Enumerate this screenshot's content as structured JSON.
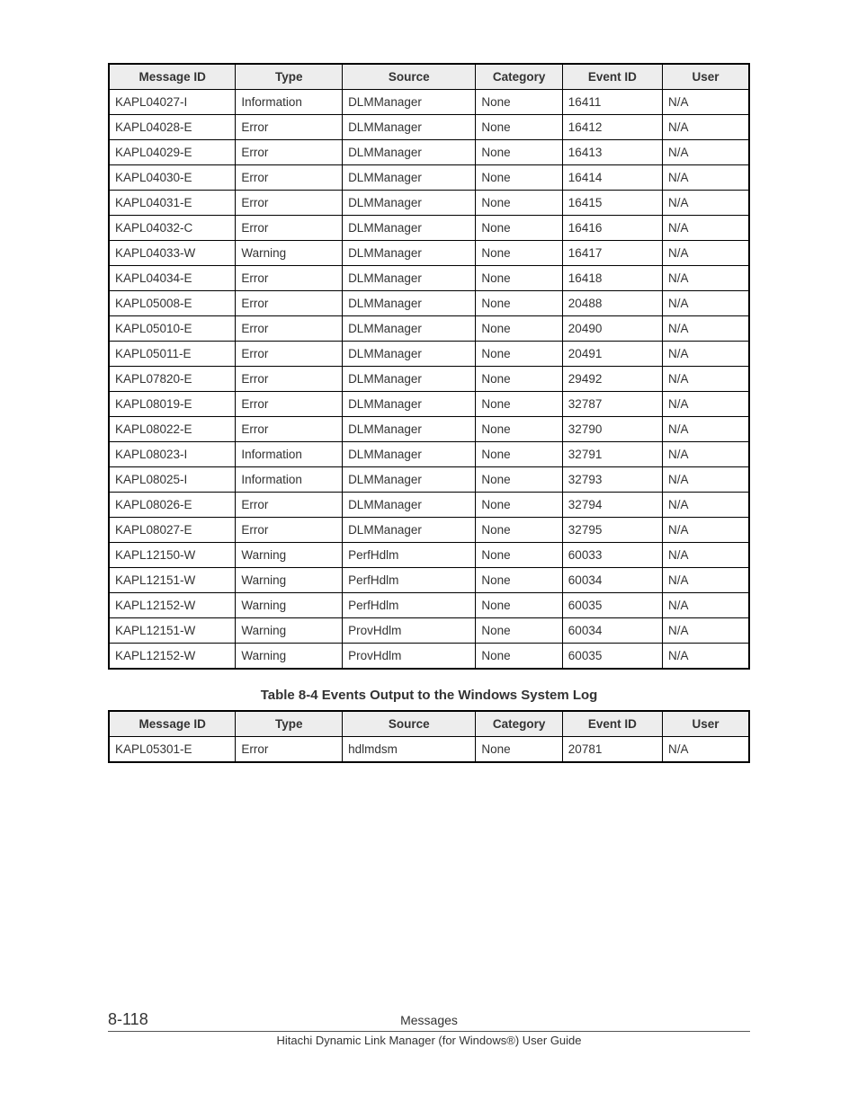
{
  "table1": {
    "headers": [
      "Message ID",
      "Type",
      "Source",
      "Category",
      "Event ID",
      "User"
    ],
    "rows": [
      [
        "KAPL04027-I",
        "Information",
        "DLMManager",
        "None",
        "16411",
        "N/A"
      ],
      [
        "KAPL04028-E",
        "Error",
        "DLMManager",
        "None",
        "16412",
        "N/A"
      ],
      [
        "KAPL04029-E",
        "Error",
        "DLMManager",
        "None",
        "16413",
        "N/A"
      ],
      [
        "KAPL04030-E",
        "Error",
        "DLMManager",
        "None",
        "16414",
        "N/A"
      ],
      [
        "KAPL04031-E",
        "Error",
        "DLMManager",
        "None",
        "16415",
        "N/A"
      ],
      [
        "KAPL04032-C",
        "Error",
        "DLMManager",
        "None",
        "16416",
        "N/A"
      ],
      [
        "KAPL04033-W",
        "Warning",
        "DLMManager",
        "None",
        "16417",
        "N/A"
      ],
      [
        "KAPL04034-E",
        "Error",
        "DLMManager",
        "None",
        "16418",
        "N/A"
      ],
      [
        "KAPL05008-E",
        "Error",
        "DLMManager",
        "None",
        "20488",
        "N/A"
      ],
      [
        "KAPL05010-E",
        "Error",
        "DLMManager",
        "None",
        "20490",
        "N/A"
      ],
      [
        "KAPL05011-E",
        "Error",
        "DLMManager",
        "None",
        "20491",
        "N/A"
      ],
      [
        "KAPL07820-E",
        "Error",
        "DLMManager",
        "None",
        "29492",
        "N/A"
      ],
      [
        "KAPL08019-E",
        "Error",
        "DLMManager",
        "None",
        "32787",
        "N/A"
      ],
      [
        "KAPL08022-E",
        "Error",
        "DLMManager",
        "None",
        "32790",
        "N/A"
      ],
      [
        "KAPL08023-I",
        "Information",
        "DLMManager",
        "None",
        "32791",
        "N/A"
      ],
      [
        "KAPL08025-I",
        "Information",
        "DLMManager",
        "None",
        "32793",
        "N/A"
      ],
      [
        "KAPL08026-E",
        "Error",
        "DLMManager",
        "None",
        "32794",
        "N/A"
      ],
      [
        "KAPL08027-E",
        "Error",
        "DLMManager",
        "None",
        "32795",
        "N/A"
      ],
      [
        "KAPL12150-W",
        "Warning",
        "PerfHdlm",
        "None",
        "60033",
        "N/A"
      ],
      [
        "KAPL12151-W",
        "Warning",
        "PerfHdlm",
        "None",
        "60034",
        "N/A"
      ],
      [
        "KAPL12152-W",
        "Warning",
        "PerfHdlm",
        "None",
        "60035",
        "N/A"
      ],
      [
        "KAPL12151-W",
        "Warning",
        "ProvHdlm",
        "None",
        "60034",
        "N/A"
      ],
      [
        "KAPL12152-W",
        "Warning",
        "ProvHdlm",
        "None",
        "60035",
        "N/A"
      ]
    ]
  },
  "caption2": "Table 8-4 Events Output to the Windows System Log",
  "table2": {
    "headers": [
      "Message ID",
      "Type",
      "Source",
      "Category",
      "Event ID",
      "User"
    ],
    "rows": [
      [
        "KAPL05301-E",
        "Error",
        "hdlmdsm",
        "None",
        "20781",
        "N/A"
      ]
    ]
  },
  "footer": {
    "pagenum": "8-118",
    "section": "Messages",
    "guide": "Hitachi Dynamic Link Manager (for Windows®) User Guide"
  }
}
